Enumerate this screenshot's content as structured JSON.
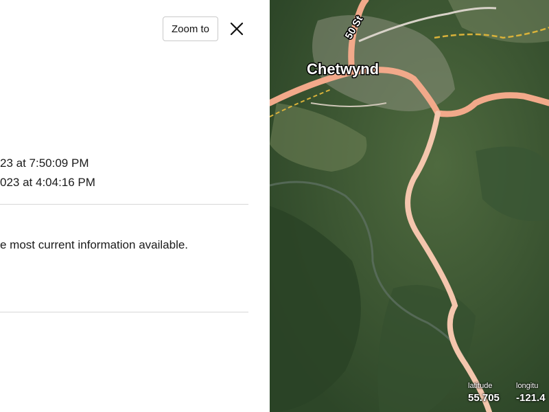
{
  "panel": {
    "zoom_label": "Zoom to",
    "close_icon": "close-icon",
    "date_line_1": "23 at 7:50:09 PM",
    "date_line_2": "023 at 4:04:16 PM",
    "note": "e most current information available."
  },
  "map": {
    "place_label": "Chetwynd",
    "road_label": "50 St",
    "latitude_label": "latitude",
    "latitude_value": "55.705",
    "longitude_label": "longitu",
    "longitude_value": "-121.4"
  },
  "colors": {
    "highway": "#f2a98a",
    "road_minor": "#d8d2c8",
    "road_yellow": "#d9b23a",
    "forest_dark": "#2f4a2c",
    "forest_light": "#5f7a4a"
  }
}
